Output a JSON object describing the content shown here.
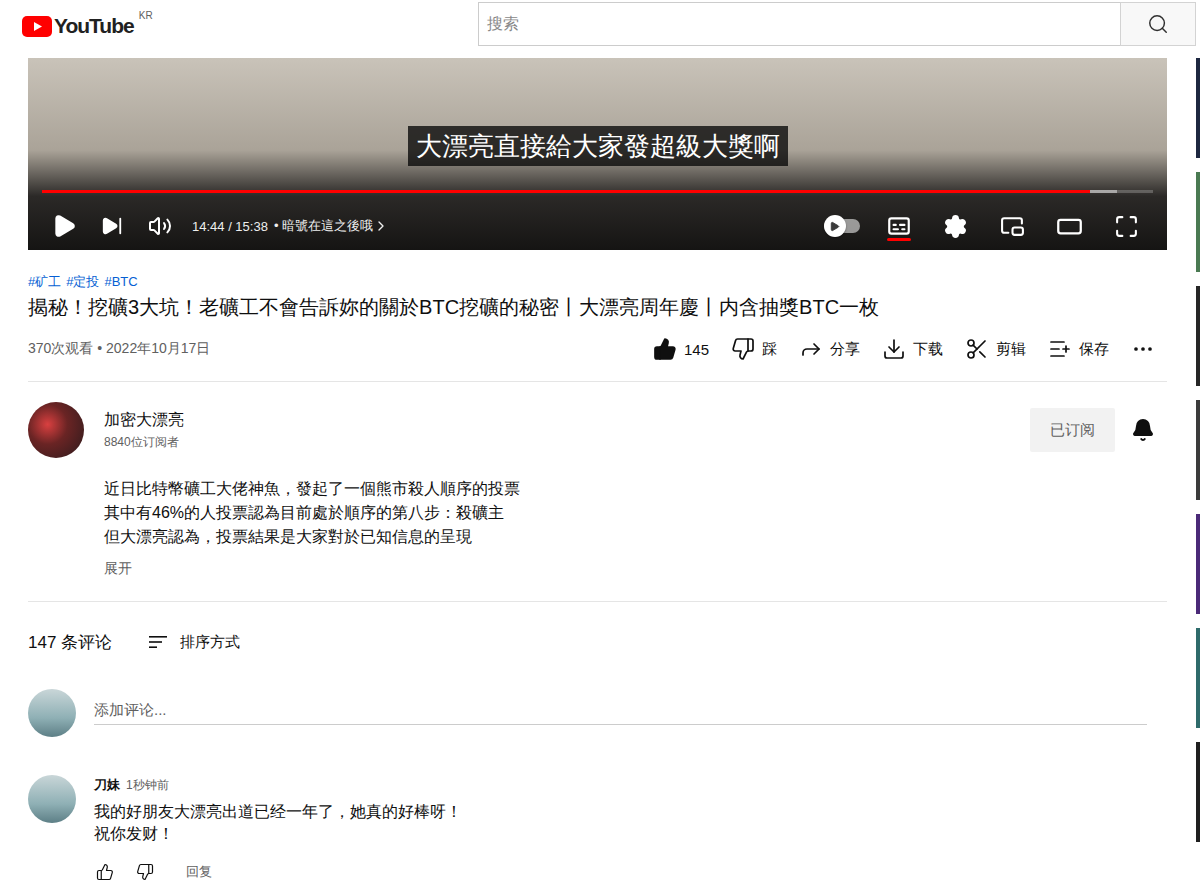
{
  "header": {
    "logo": "YouTube",
    "region": "KR",
    "search_placeholder": "搜索"
  },
  "player": {
    "caption": "大漂亮直接給大家發超級大獎啊",
    "time": "14:44 / 15:38",
    "chapter": "• 暗號在這之後哦",
    "level": 0.943,
    "buffered": 0.968,
    "captions_on": true,
    "autoplay_on": false
  },
  "video": {
    "hashtags": [
      "#矿工",
      "#定投",
      "#BTC"
    ],
    "title": "揭秘！挖礦3大坑！老礦工不會告訴妳的關於BTC挖礦的秘密丨大漂亮周年慶丨内含抽獎BTC一枚",
    "meta": "370次观看 • 2022年10月17日",
    "actions": [
      {
        "kind": "like",
        "label": "145",
        "selected": true
      },
      {
        "kind": "dislike",
        "label": "踩",
        "selected": false
      },
      {
        "kind": "share",
        "label": "分享",
        "selected": false
      },
      {
        "kind": "download",
        "label": "下载",
        "selected": false
      },
      {
        "kind": "clip",
        "label": "剪辑",
        "selected": false
      },
      {
        "kind": "save",
        "label": "保存",
        "selected": false
      },
      {
        "kind": "more",
        "selected": false
      }
    ]
  },
  "channel": {
    "name": "加密大漂亮",
    "subscribers": "8840位订阅者",
    "subscribe_button": "已订阅",
    "subscribed": true,
    "bell_on": true
  },
  "description": {
    "lines": [
      "近日比特幣礦工大佬神魚，發起了一個熊市殺人順序的投票",
      "其中有46%的人投票認為目前處於順序的第八步：殺礦主",
      "但大漂亮認為，投票結果是大家對於已知信息的呈現"
    ],
    "expand": "展开"
  },
  "comments": {
    "count": "147 条评论",
    "sort": "排序方式",
    "placeholder": "添加评论...",
    "items": [
      {
        "author": "刀妹",
        "time": "1秒钟前",
        "lines": [
          "我的好朋友大漂亮出道已经一年了，她真的好棒呀！",
          "祝你发财！"
        ],
        "reply": "回复"
      }
    ]
  }
}
